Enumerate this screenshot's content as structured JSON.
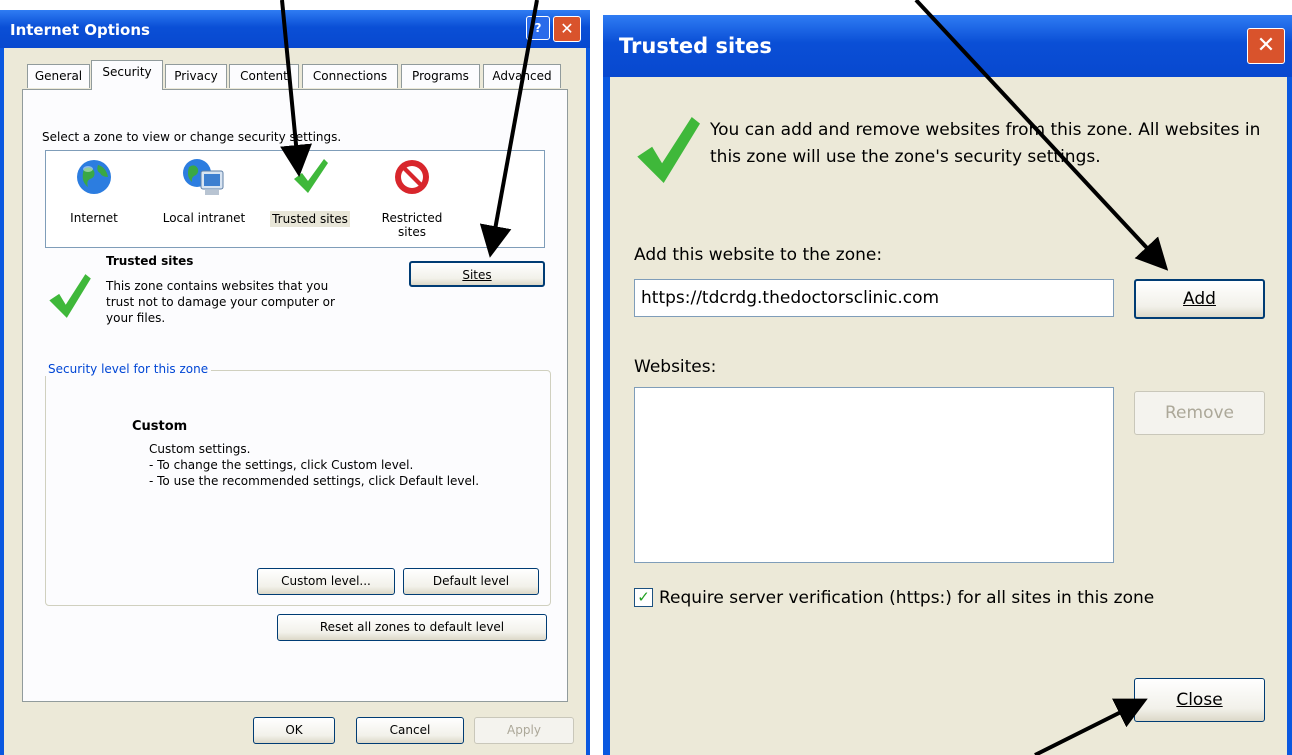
{
  "left_dialog": {
    "title": "Internet Options",
    "tabs": [
      "General",
      "Security",
      "Privacy",
      "Content",
      "Connections",
      "Programs",
      "Advanced"
    ],
    "zone_prompt": "Select a zone to view or change security settings.",
    "zones": [
      {
        "label": "Internet",
        "icon": "globe-icon"
      },
      {
        "label": "Local intranet",
        "icon": "computer-icon"
      },
      {
        "label": "Trusted sites",
        "icon": "checkmark-icon"
      },
      {
        "label": "Restricted sites",
        "icon": "no-entry-icon"
      }
    ],
    "zone_title": "Trusted sites",
    "zone_desc": [
      "This zone contains websites that you",
      "trust not to damage your computer or",
      "your files."
    ],
    "sites_button": "Sites",
    "security_group": "Security level for this zone",
    "level_name": "Custom",
    "level_desc": [
      "Custom settings.",
      "- To change the settings, click Custom level.",
      "- To use the recommended settings, click Default level."
    ],
    "custom_level_button": "Custom level...",
    "default_level_button": "Default level",
    "reset_button": "Reset all zones to default level",
    "ok": "OK",
    "cancel": "Cancel",
    "apply": "Apply"
  },
  "right_dialog": {
    "title": "Trusted sites",
    "info": [
      "You can add and remove websites from this zone. All websites in",
      "this zone will use the zone's security settings."
    ],
    "add_label": "Add this website to the zone:",
    "url_value": "https://tdcrdg.thedoctorsclinic.com",
    "add_button": "Add",
    "websites_label": "Websites:",
    "remove_button": "Remove",
    "require_https": "Require server verification (https:) for all sites in this zone",
    "require_https_checked": true,
    "close_button": "Close"
  },
  "colors": {
    "titlebar": "#0a58e0",
    "dialog_bg": "#ece9d8",
    "close_red": "#d9532c",
    "check_green": "#3fb83a"
  }
}
